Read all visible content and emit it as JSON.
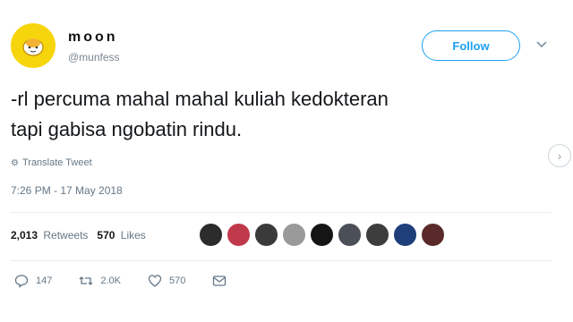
{
  "user": {
    "display_name": "moon",
    "handle": "@munfess",
    "avatar_color": "#f7d50c"
  },
  "follow_label": "Follow",
  "tweet": {
    "line1": "-rl percuma mahal mahal kuliah kedokteran",
    "line2": "tapi gabisa ngobatin rindu."
  },
  "translate_label": "Translate Tweet",
  "timestamp": "7:26 PM - 17 May 2018",
  "stats": {
    "retweets_count": "2,013",
    "retweets_label": "Retweets",
    "likes_count": "570",
    "likes_label": "Likes"
  },
  "likers": [
    "#2c2c2c",
    "#c0394a",
    "#3a3a3a",
    "#9a9a9a",
    "#151515",
    "#4a4f58",
    "#3d3d3d",
    "#1f3f7a",
    "#5a2a2a"
  ],
  "actions": {
    "reply_count": "147",
    "retweet_count": "2.0K",
    "like_count": "570"
  },
  "colors": {
    "accent": "#1da1f2",
    "muted_text": "#657786"
  }
}
